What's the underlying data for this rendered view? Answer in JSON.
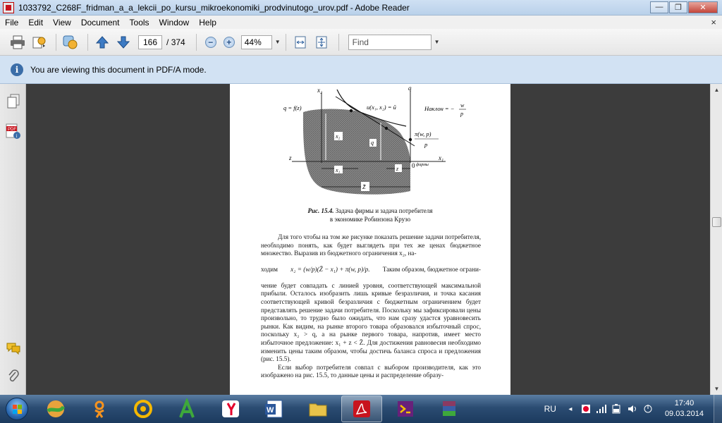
{
  "window": {
    "title": "1033792_C268F_fridman_a_a_lekcii_po_kursu_mikroekonomiki_prodvinutogo_urov.pdf - Adobe Reader",
    "minimize": "—",
    "maximize": "❐",
    "close": "✕"
  },
  "menu": {
    "items": [
      "File",
      "Edit",
      "View",
      "Document",
      "Tools",
      "Window",
      "Help"
    ],
    "close_doc": "×"
  },
  "toolbar": {
    "page_current": "166",
    "page_separator": "/",
    "page_total": "374",
    "zoom_out": "−",
    "zoom_in": "+",
    "zoom_level": "44%",
    "find_placeholder": "Find"
  },
  "infobar": {
    "icon": "i",
    "message": "You are viewing this document in PDF/A mode."
  },
  "document": {
    "figure": {
      "labels": {
        "x2": "x₂",
        "q_axis": "q",
        "q_fz": "q = f(z)",
        "utility": "u(x₁, x₂) = ū",
        "slope_label": "Наклон = −",
        "slope_num": "w",
        "slope_den": "p",
        "profit_num": "π(w, p)",
        "profit_den": "p",
        "x2_box": "x₂",
        "q_box": "q",
        "z_axis": "z",
        "origin": "0",
        "origin_sub": "фирмы",
        "x1_axis": "x₁",
        "x1_seg": "x₁",
        "z_seg": "z",
        "zbar_seg": "Z̄"
      }
    },
    "caption": {
      "prefix": "Рис. 15.4.",
      "line1": " Задача фирмы и задача потребителя",
      "line2": "в экономике Робинзона Крузо"
    },
    "para1": "Для того чтобы на том же рисунке показать решение задачи потребителя, необходимо понять, как будет выглядеть при тех же ценах бюджетное множество. Выразив из бюджетного ограничения x₂, на-",
    "formula_left": "ходим",
    "formula": "x₂ = (w/p)(Z̄ − x₁) + π(w, p)/p.",
    "formula_right": "Таким образом, бюджетное ограни-",
    "para2": "чение будет совпадать с линией уровня, соответствующей максимальной прибыли. Осталось изобразить лишь кривые безразличия, и точка касания соответствующей кривой безразличия с бюджетным ограничением будет представлять решение задачи потребителя. Поскольку мы зафиксировали цены произвольно, то трудно было ожидать, что нам сразу удастся уравновесить рынки. Как видим, на рынке второго товара образовался избыточный спрос, поскольку x₂ > q, а на рынке первого товара, напротив, имеет место избыточное предложение: x₁ + z < Z̄. Для достижения равновесия необходимо изменить цены таким образом, чтобы достичь баланса спроса и предложения (рис. 15.5).",
    "para3": "Если выбор потребителя совпал с выбором производителя, как это изображено на рис. 15.5, то данные цены и распределение образу-"
  },
  "taskbar": {
    "language": "RU",
    "time": "17:40",
    "date": "09.03.2014",
    "apps": [
      {
        "name": "chrome-like",
        "color": "#e8a33c"
      },
      {
        "name": "odnoklassniki",
        "color": "#f7931e"
      },
      {
        "name": "mail-agent",
        "color": "#f5b800"
      },
      {
        "name": "green-a",
        "color": "#3ea83b"
      },
      {
        "name": "yandex-browser",
        "color": "#e4002b"
      },
      {
        "name": "word",
        "color": "#2b579a"
      },
      {
        "name": "explorer",
        "color": "#e9c34a"
      },
      {
        "name": "adobe-reader",
        "color": "#c8141e"
      },
      {
        "name": "visual-studio",
        "color": "#68217a"
      },
      {
        "name": "winrar",
        "color": "#8b3a62"
      }
    ]
  },
  "colors": {
    "accent": "#c8141e",
    "infobar_bg": "#d2e2f3",
    "doc_bg": "#3c3c3c"
  }
}
